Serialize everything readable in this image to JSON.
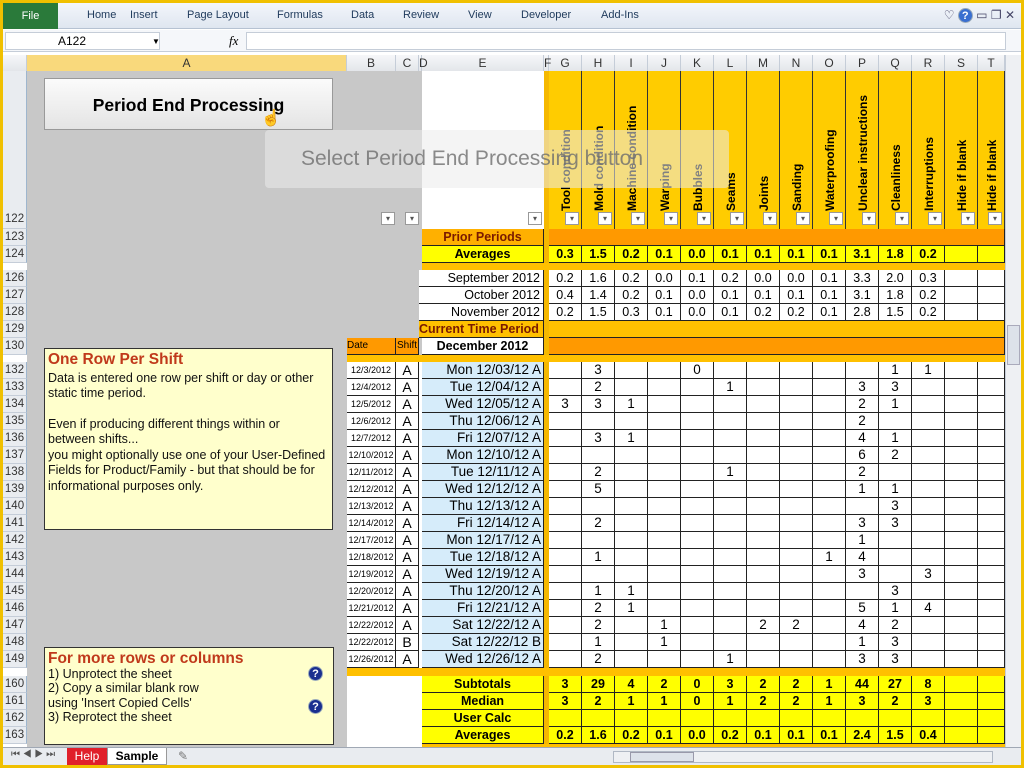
{
  "ribbon": {
    "file": "File",
    "tabs": [
      "Home",
      "Insert",
      "Page Layout",
      "Formulas",
      "Data",
      "Review",
      "View",
      "Developer",
      "Add-Ins"
    ]
  },
  "formula_bar": {
    "name_box": "A122",
    "fx": "fx",
    "value": ""
  },
  "columns": [
    "A",
    "B",
    "C",
    "D",
    "E",
    "F",
    "G",
    "H",
    "I",
    "J",
    "K",
    "L",
    "M",
    "N",
    "O",
    "P",
    "Q",
    "R",
    "S",
    "T"
  ],
  "selected_column": "A",
  "button": {
    "label": "Period End Processing"
  },
  "tooltip": "Select Period End Processing button",
  "categories": [
    "Tool condition",
    "Mold condition",
    "Machine condition",
    "Warping",
    "Bubbles",
    "Seams",
    "Joints",
    "Sanding",
    "Waterproofing",
    "Unclear instructions",
    "Cleanliness",
    "Interruptions",
    "Hide if blank",
    "Hide if blank"
  ],
  "prior": {
    "label": "Prior Periods",
    "averages_label": "Averages",
    "averages": [
      "0.3",
      "1.5",
      "0.2",
      "0.1",
      "0.0",
      "0.1",
      "0.1",
      "0.1",
      "0.1",
      "3.1",
      "1.8",
      "0.2"
    ],
    "months": [
      {
        "label": "September 2012",
        "values": [
          "0.2",
          "1.6",
          "0.2",
          "0.0",
          "0.1",
          "0.2",
          "0.0",
          "0.0",
          "0.1",
          "3.3",
          "2.0",
          "0.3"
        ]
      },
      {
        "label": "October 2012",
        "values": [
          "0.4",
          "1.4",
          "0.2",
          "0.1",
          "0.0",
          "0.1",
          "0.1",
          "0.1",
          "0.1",
          "3.1",
          "1.8",
          "0.2"
        ]
      },
      {
        "label": "November 2012",
        "values": [
          "0.2",
          "1.5",
          "0.3",
          "0.1",
          "0.0",
          "0.1",
          "0.2",
          "0.2",
          "0.1",
          "2.8",
          "1.5",
          "0.2"
        ]
      }
    ]
  },
  "current": {
    "label": "Current Time Period",
    "date_header": "Date",
    "shift_header": "Shift",
    "month": "December 2012"
  },
  "rows": [
    {
      "row": "132",
      "date": "12/3/2012",
      "shift": "A",
      "label": "Mon 12/03/12 A",
      "values": [
        "",
        "3",
        "",
        "",
        "0",
        "",
        "",
        "",
        "",
        "",
        "1",
        "1"
      ]
    },
    {
      "row": "133",
      "date": "12/4/2012",
      "shift": "A",
      "label": "Tue 12/04/12 A",
      "values": [
        "",
        "2",
        "",
        "",
        "",
        "1",
        "",
        "",
        "",
        "3",
        "3",
        ""
      ]
    },
    {
      "row": "134",
      "date": "12/5/2012",
      "shift": "A",
      "label": "Wed 12/05/12 A",
      "values": [
        "3",
        "3",
        "1",
        "",
        "",
        "",
        "",
        "",
        "",
        "2",
        "1",
        ""
      ]
    },
    {
      "row": "135",
      "date": "12/6/2012",
      "shift": "A",
      "label": "Thu 12/06/12 A",
      "values": [
        "",
        "",
        "",
        "",
        "",
        "",
        "",
        "",
        "",
        "2",
        "",
        ""
      ]
    },
    {
      "row": "136",
      "date": "12/7/2012",
      "shift": "A",
      "label": "Fri 12/07/12 A",
      "values": [
        "",
        "3",
        "1",
        "",
        "",
        "",
        "",
        "",
        "",
        "4",
        "1",
        ""
      ]
    },
    {
      "row": "137",
      "date": "12/10/2012",
      "shift": "A",
      "label": "Mon 12/10/12 A",
      "values": [
        "",
        "",
        "",
        "",
        "",
        "",
        "",
        "",
        "",
        "6",
        "2",
        ""
      ]
    },
    {
      "row": "138",
      "date": "12/11/2012",
      "shift": "A",
      "label": "Tue 12/11/12 A",
      "values": [
        "",
        "2",
        "",
        "",
        "",
        "1",
        "",
        "",
        "",
        "2",
        "",
        ""
      ]
    },
    {
      "row": "139",
      "date": "12/12/2012",
      "shift": "A",
      "label": "Wed 12/12/12 A",
      "values": [
        "",
        "5",
        "",
        "",
        "",
        "",
        "",
        "",
        "",
        "1",
        "1",
        ""
      ]
    },
    {
      "row": "140",
      "date": "12/13/2012",
      "shift": "A",
      "label": "Thu 12/13/12 A",
      "values": [
        "",
        "",
        "",
        "",
        "",
        "",
        "",
        "",
        "",
        "",
        "3",
        ""
      ]
    },
    {
      "row": "141",
      "date": "12/14/2012",
      "shift": "A",
      "label": "Fri 12/14/12 A",
      "values": [
        "",
        "2",
        "",
        "",
        "",
        "",
        "",
        "",
        "",
        "3",
        "3",
        ""
      ]
    },
    {
      "row": "142",
      "date": "12/17/2012",
      "shift": "A",
      "label": "Mon 12/17/12 A",
      "values": [
        "",
        "",
        "",
        "",
        "",
        "",
        "",
        "",
        "",
        "1",
        "",
        ""
      ]
    },
    {
      "row": "143",
      "date": "12/18/2012",
      "shift": "A",
      "label": "Tue 12/18/12 A",
      "values": [
        "",
        "1",
        "",
        "",
        "",
        "",
        "",
        "",
        "1",
        "4",
        "",
        ""
      ]
    },
    {
      "row": "144",
      "date": "12/19/2012",
      "shift": "A",
      "label": "Wed 12/19/12 A",
      "values": [
        "",
        "",
        "",
        "",
        "",
        "",
        "",
        "",
        "",
        "3",
        "",
        "3"
      ]
    },
    {
      "row": "145",
      "date": "12/20/2012",
      "shift": "A",
      "label": "Thu 12/20/12 A",
      "values": [
        "",
        "1",
        "1",
        "",
        "",
        "",
        "",
        "",
        "",
        "",
        "3",
        ""
      ]
    },
    {
      "row": "146",
      "date": "12/21/2012",
      "shift": "A",
      "label": "Fri 12/21/12 A",
      "values": [
        "",
        "2",
        "1",
        "",
        "",
        "",
        "",
        "",
        "",
        "5",
        "1",
        "4"
      ]
    },
    {
      "row": "147",
      "date": "12/22/2012",
      "shift": "A",
      "label": "Sat 12/22/12 A",
      "values": [
        "",
        "2",
        "",
        "1",
        "",
        "",
        "2",
        "2",
        "",
        "4",
        "2",
        ""
      ]
    },
    {
      "row": "148",
      "date": "12/22/2012",
      "shift": "B",
      "label": "Sat 12/22/12 B",
      "values": [
        "",
        "1",
        "",
        "1",
        "",
        "",
        "",
        "",
        "",
        "1",
        "3",
        ""
      ]
    },
    {
      "row": "149",
      "date": "12/26/2012",
      "shift": "A",
      "label": "Wed 12/26/12 A",
      "values": [
        "",
        "2",
        "",
        "",
        "",
        "1",
        "",
        "",
        "",
        "3",
        "3",
        ""
      ]
    }
  ],
  "summary": [
    {
      "row": "160",
      "label": "Subtotals",
      "values": [
        "3",
        "29",
        "4",
        "2",
        "0",
        "3",
        "2",
        "2",
        "1",
        "44",
        "27",
        "8"
      ]
    },
    {
      "row": "161",
      "label": "Median",
      "values": [
        "3",
        "2",
        "1",
        "1",
        "0",
        "1",
        "2",
        "2",
        "1",
        "3",
        "2",
        "3"
      ]
    },
    {
      "row": "162",
      "label": "User Calc",
      "values": [
        "",
        "",
        "",
        "",
        "",
        "",
        "",
        "",
        "",
        "",
        "",
        ""
      ]
    },
    {
      "row": "163",
      "label": "Averages",
      "values": [
        "0.2",
        "1.6",
        "0.2",
        "0.1",
        "0.0",
        "0.2",
        "0.1",
        "0.1",
        "0.1",
        "2.4",
        "1.5",
        "0.4"
      ]
    }
  ],
  "prior_rows": [
    "123",
    "124",
    "126",
    "127",
    "128",
    "129",
    "130"
  ],
  "help_box_1": {
    "title": "One Row Per Shift",
    "lines": [
      "Data is entered one row per shift or day or other static time period.",
      "",
      "Even if producing different things within or between shifts...",
      "you might optionally use one of your User-Defined Fields for Product/Family - but that should be for informational purposes only."
    ]
  },
  "help_box_2": {
    "title": "For more rows or columns",
    "lines": [
      "1) Unprotect the sheet",
      "2) Copy a similar blank row",
      "using 'Insert Copied Cells'",
      "3) Reprotect the sheet"
    ]
  },
  "sheet_tabs": [
    "Help",
    "Sample"
  ],
  "colors": {
    "header_yellow": "#ffcc00",
    "orange": "#ff9900",
    "bright_yellow": "#ffff00",
    "label_blue": "#d6ecfa",
    "help_tab": "#e0202a",
    "title_red": "#c0391b"
  }
}
